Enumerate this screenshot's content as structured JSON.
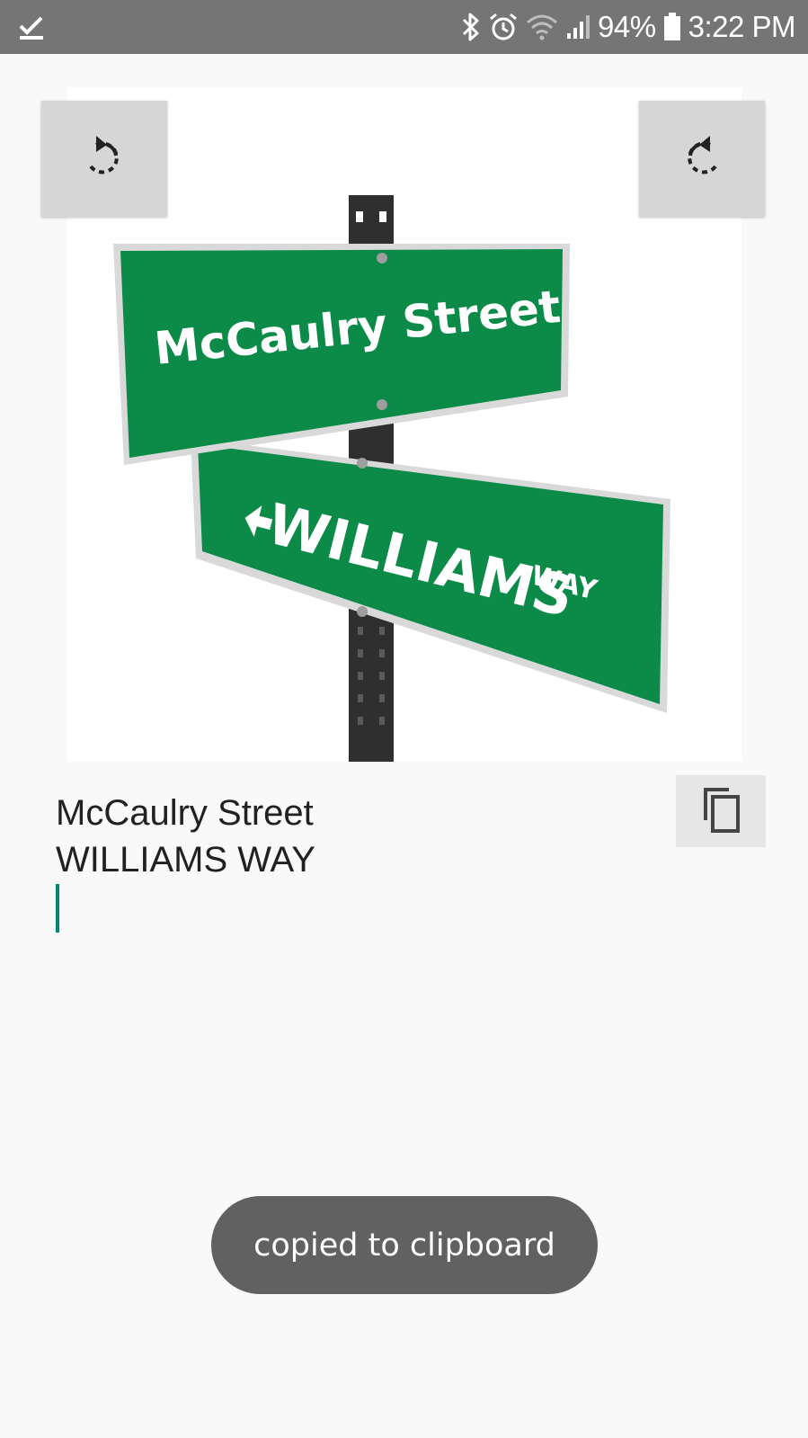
{
  "status_bar": {
    "battery_percent": "94%",
    "time": "3:22 PM",
    "icons": [
      "download-done-icon",
      "bluetooth-icon",
      "alarm-icon",
      "wifi-icon",
      "signal-icon",
      "battery-icon"
    ]
  },
  "image": {
    "sign_top": "McCaulry Street",
    "sign_bottom_main": "WILLIAMS",
    "sign_bottom_small": "WAY",
    "sign_color": "#0b8a48"
  },
  "result": {
    "line1": "McCaulry Street",
    "line2": "WILLIAMS WAY"
  },
  "toast": {
    "message": "copied to clipboard"
  },
  "colors": {
    "cursor": "#00897b",
    "status_bar": "#757575"
  }
}
